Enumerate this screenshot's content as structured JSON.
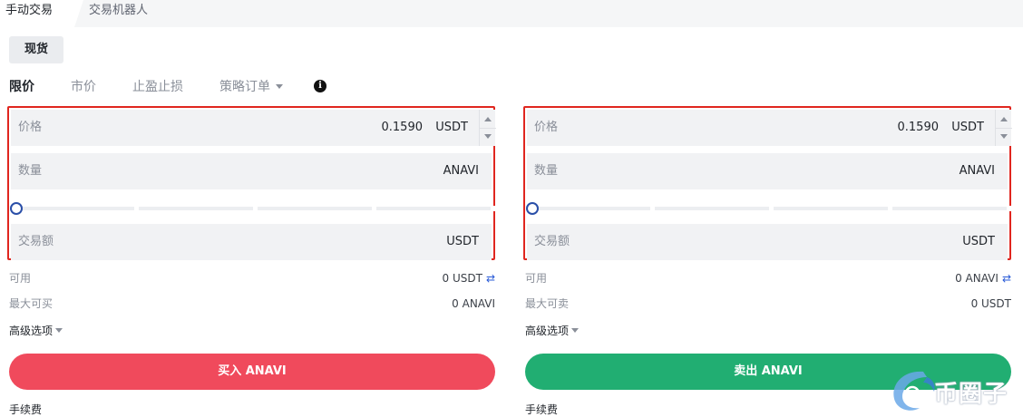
{
  "tabs": {
    "manual": "手动交易",
    "bot": "交易机器人"
  },
  "market": {
    "spot_label": "现货"
  },
  "order_types": {
    "limit": "限价",
    "market": "市价",
    "tpsl": "止盈止损",
    "strategy": "策略订单"
  },
  "buy_panel": {
    "price_label": "价格",
    "price_value": "0.1590",
    "price_unit": "USDT",
    "qty_label": "数量",
    "qty_unit": "ANAVI",
    "total_label": "交易额",
    "total_unit": "USDT",
    "available_label": "可用",
    "available_value": "0 USDT",
    "max_label": "最大可买",
    "max_value": "0 ANAVI",
    "advanced_label": "高级选项",
    "button_label": "买入 ANAVI",
    "fee_label": "手续费"
  },
  "sell_panel": {
    "price_label": "价格",
    "price_value": "0.1590",
    "price_unit": "USDT",
    "qty_label": "数量",
    "qty_unit": "ANAVI",
    "total_label": "交易额",
    "total_unit": "USDT",
    "available_label": "可用",
    "available_value": "0 ANAVI",
    "max_label": "最大可卖",
    "max_value": "0 USDT",
    "advanced_label": "高级选项",
    "button_label": "卖出 ANAVI",
    "fee_label": "手续费"
  },
  "slider_percent": 0,
  "watermark": {
    "text": "币圈子"
  },
  "colors": {
    "buy": "#f04a5c",
    "sell": "#21ae72",
    "highlight_border": "#e0261f",
    "slider_knob": "#2a4fa8"
  },
  "icons": {
    "info": "info-icon",
    "swap": "swap-arrows-icon",
    "stepper": "stepper-arrows-icon",
    "dropdown": "caret-down-icon"
  }
}
